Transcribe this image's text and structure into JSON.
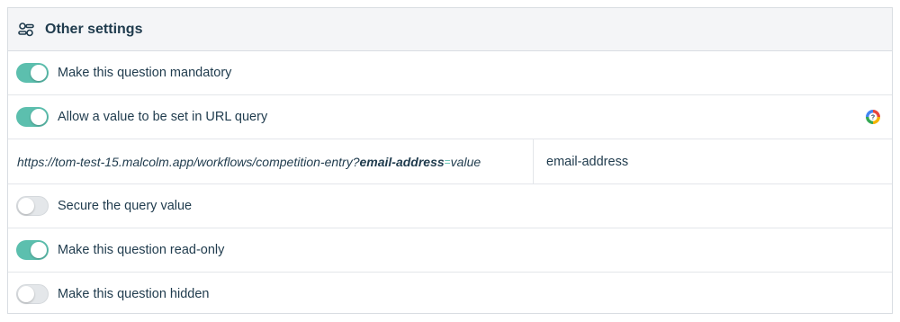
{
  "header": {
    "title": "Other settings",
    "icon": "settings-sliders-icon"
  },
  "rows": [
    {
      "label": "Make this question mandatory",
      "enabled": true
    },
    {
      "label": "Allow a value to be set in URL query",
      "enabled": true
    },
    {
      "label": "Secure the query value",
      "enabled": false
    },
    {
      "label": "Make this question read-only",
      "enabled": true
    },
    {
      "label": "Make this question hidden",
      "enabled": false
    }
  ],
  "url": {
    "prefix": "https://tom-test-15.malcolm.app/workflows/competition-entry?",
    "param": "email-address",
    "equals": "=",
    "suffix": "value",
    "input_value": "email-address"
  },
  "colors": {
    "accent": "#5cbfae",
    "text": "#1f3b4d",
    "header_bg": "#f4f5f7",
    "border": "#d9dde2"
  }
}
